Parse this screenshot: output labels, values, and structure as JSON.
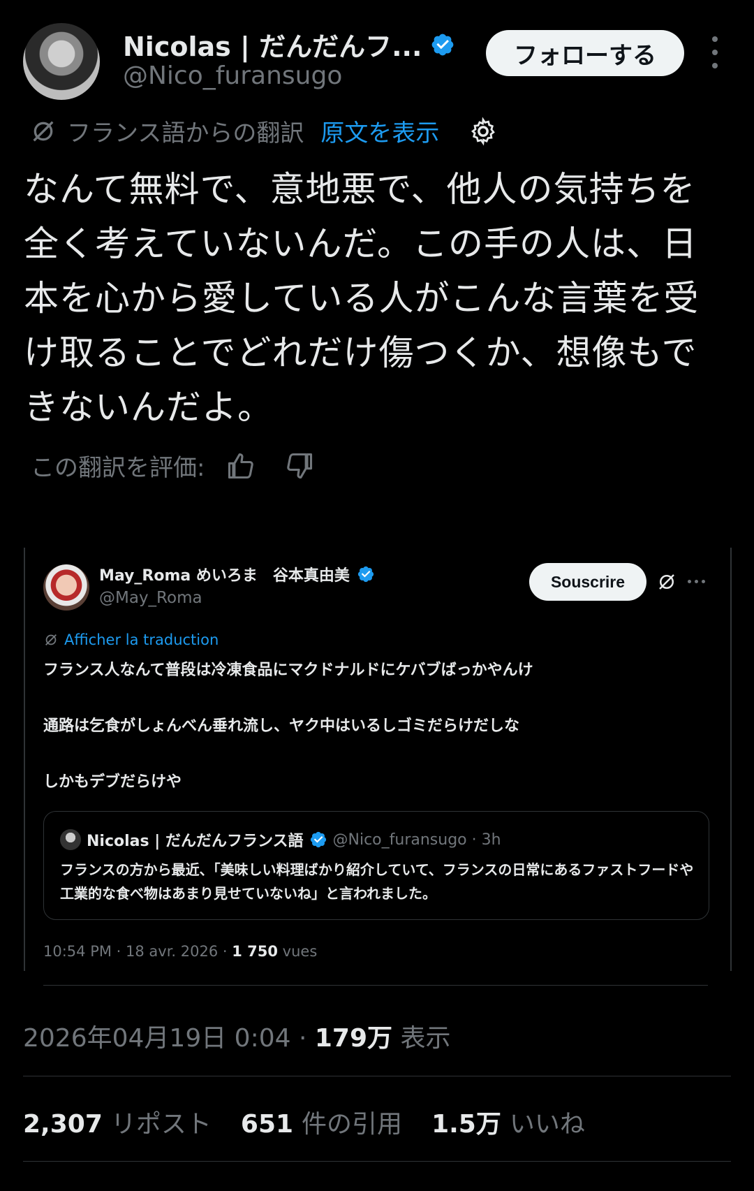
{
  "author": {
    "display_name": "Nicolas | だんだんフ...",
    "handle": "@Nico_furansugo",
    "follow_label": "フォローする"
  },
  "translation": {
    "label": "フランス語からの翻訳",
    "show_original": "原文を表示"
  },
  "body_text": "なんて無料で、意地悪で、他人の気持ちを全く考えていないんだ。この手の人は、日本を心から愛している人がこんな言葉を受け取ることでどれだけ傷つくか、想像もできないんだよ。",
  "rate": {
    "label": "この翻訳を評価:"
  },
  "quote": {
    "display_name": "May_Roma めいろま　谷本真由美",
    "handle": "@May_Roma",
    "subscribe_label": "Souscrire",
    "show_translation": "Afficher la traduction",
    "paragraphs": [
      "フランス人なんて普段は冷凍食品にマクドナルドにケバブばっかやんけ",
      "通路は乞食がしょんべん垂れ流し、ヤク中はいるしゴミだらけだしな",
      "しかもデブだらけや"
    ],
    "inner": {
      "display_name": "Nicolas | だんだんフランス語",
      "handle_time": "@Nico_furansugo · 3h",
      "text": "フランスの方から最近、「美味しい料理ばかり紹介していて、フランスの日常にあるファストフードや工業的な食べ物はあまり見せていないね」と言われました。"
    },
    "meta_time": "10:54 PM · 18 avr. 2026 · ",
    "meta_views": "1 750",
    "meta_views_label": " vues"
  },
  "footer": {
    "datetime": "2026年04月19日 0:04 · ",
    "views": "179万",
    "views_label": " 表示",
    "stats": [
      {
        "num": "2,307",
        "label": "リポスト"
      },
      {
        "num": "651",
        "label": "件の引用"
      },
      {
        "num": "1.5万",
        "label": "いいね"
      }
    ]
  },
  "colors": {
    "accent": "#1d9bf0",
    "muted": "#71767b",
    "text": "#e7e9ea",
    "border": "#2f3336"
  },
  "icons": [
    "verified-badge-icon",
    "grok-translate-icon",
    "gear-icon",
    "thumbs-up-icon",
    "thumbs-down-icon",
    "more-icon"
  ]
}
